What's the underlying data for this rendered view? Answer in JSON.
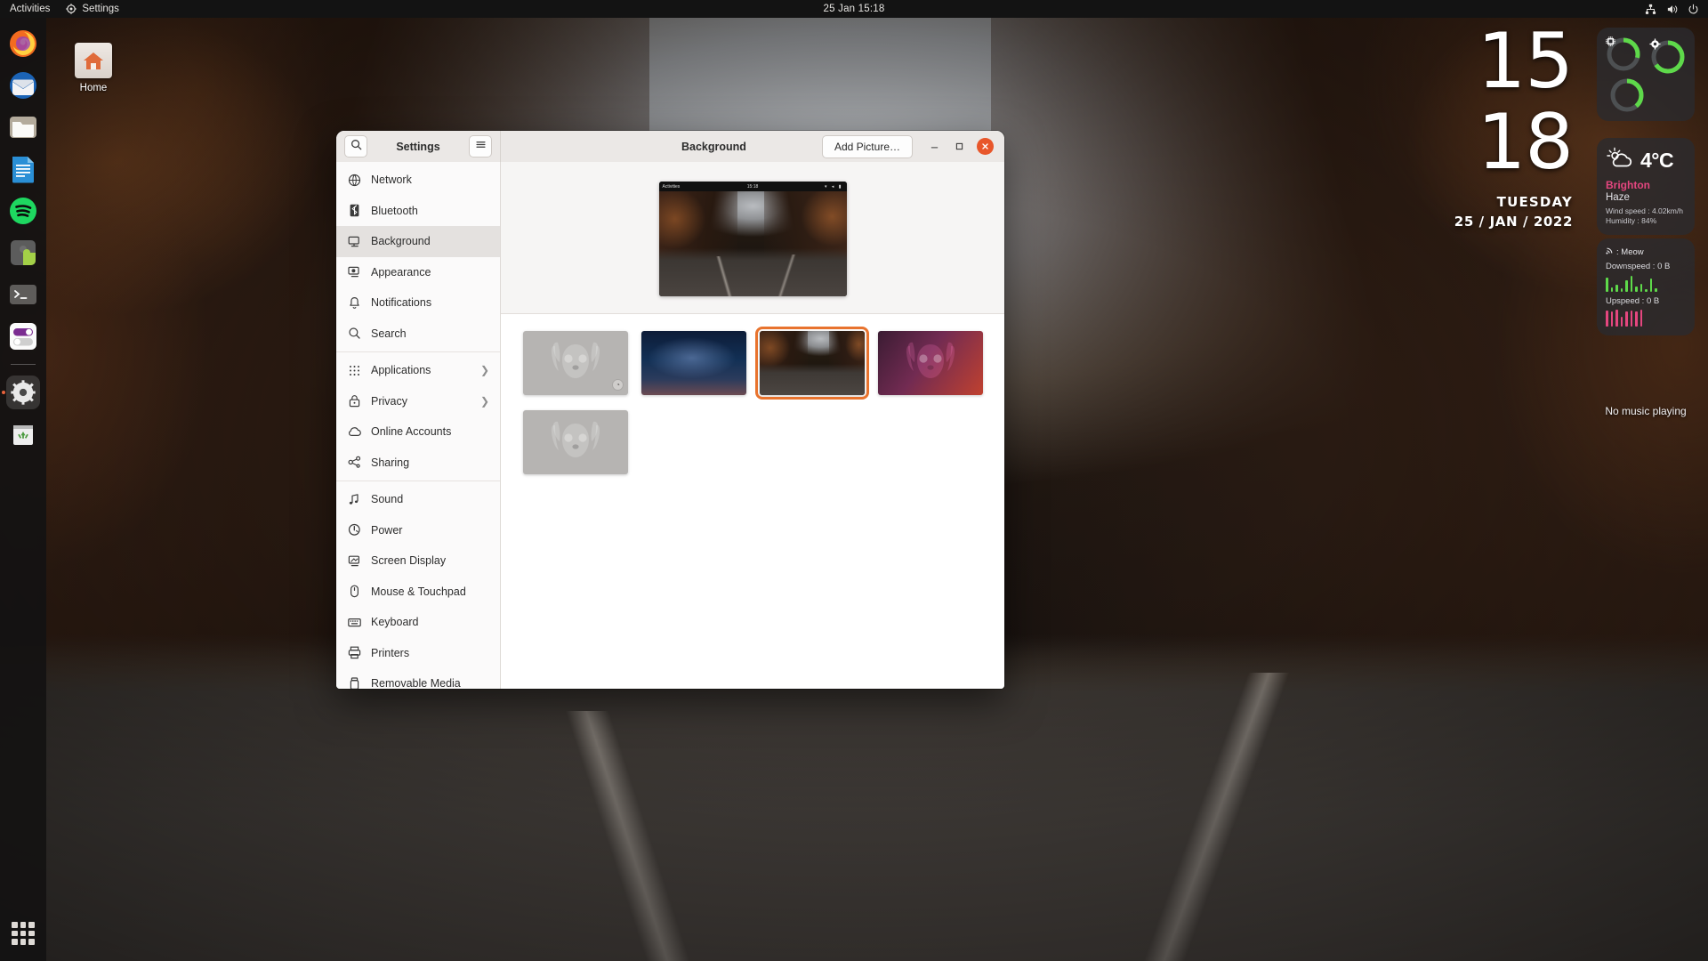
{
  "topbar": {
    "activities": "Activities",
    "app_name": "Settings",
    "app_icon": "gear-icon",
    "clock": "25 Jan  15:18",
    "tray": [
      {
        "name": "network-icon",
        "glyph": "⛓"
      },
      {
        "name": "volume-icon",
        "glyph": "▶"
      },
      {
        "name": "power-icon",
        "glyph": "⏻"
      }
    ]
  },
  "dock": {
    "items": [
      {
        "name": "firefox",
        "label": "Firefox"
      },
      {
        "name": "thunderbird",
        "label": "Thunderbird"
      },
      {
        "name": "files",
        "label": "Files"
      },
      {
        "name": "libreoffice-writer",
        "label": "LibreOffice Writer"
      },
      {
        "name": "spotify",
        "label": "Spotify"
      },
      {
        "name": "extensions",
        "label": "Extensions"
      },
      {
        "name": "terminal",
        "label": "Terminal"
      },
      {
        "name": "tweaks",
        "label": "Tweaks"
      },
      {
        "name": "settings",
        "label": "Settings",
        "running": true
      },
      {
        "name": "trash",
        "label": "Trash"
      }
    ],
    "show_apps_label": "Show Applications"
  },
  "desktop": {
    "home_icon_label": "Home"
  },
  "conky": {
    "hours": "15",
    "minutes": "18",
    "weekday": "TUESDAY",
    "date": "25 / JAN / 2022",
    "system": {
      "gauges": [
        {
          "name": "memory-gauge",
          "icon": "chip-icon",
          "percent": 28
        },
        {
          "name": "cpu-gauge",
          "icon": "gear-icon",
          "percent": 62
        },
        {
          "name": "disk-gauge",
          "icon": "",
          "percent": 38
        }
      ]
    },
    "weather": {
      "icon": "sun-cloud-icon",
      "temperature": "4°C",
      "city": "Brighton",
      "condition": "Haze",
      "wind": "Wind speed : 4.02km/h",
      "humidity": "Humidity : 84%"
    },
    "network": {
      "ssid": "\u0001 : Meow",
      "ssid_label": ": Meow",
      "downspeed": "Downspeed : 0 B",
      "upspeed": "Upspeed : 0 B",
      "down_bars": [
        16,
        5,
        8,
        4,
        13,
        18,
        6,
        9,
        3,
        15,
        4
      ],
      "up_bars": [
        18,
        17,
        19,
        11,
        17,
        18,
        17,
        19
      ]
    },
    "music": "No music playing",
    "colors": {
      "accent_green": "#5ed94a",
      "accent_pink": "#e4467f",
      "city_pink": "#e4467f"
    }
  },
  "settings_window": {
    "sidebar_title": "Settings",
    "search_icon": "search-icon",
    "menu_icon": "hamburger-icon",
    "page_title": "Background",
    "add_picture_label": "Add Picture…",
    "window_buttons": {
      "minimize": "–",
      "maximize": "□",
      "close": "✕"
    },
    "nav": [
      {
        "label": "Network",
        "icon": "globe-icon",
        "active": false,
        "chevron": false
      },
      {
        "label": "Bluetooth",
        "icon": "bluetooth-icon",
        "active": false,
        "chevron": false
      },
      {
        "label": "Background",
        "icon": "monitor-icon",
        "active": true,
        "chevron": false
      },
      {
        "label": "Appearance",
        "icon": "appearance-icon",
        "active": false,
        "chevron": false
      },
      {
        "label": "Notifications",
        "icon": "bell-icon",
        "active": false,
        "chevron": false
      },
      {
        "label": "Search",
        "icon": "search-icon",
        "active": false,
        "chevron": false
      },
      {
        "label": "Applications",
        "icon": "apps-grid-icon",
        "active": false,
        "chevron": true
      },
      {
        "label": "Privacy",
        "icon": "lock-icon",
        "active": false,
        "chevron": true
      },
      {
        "label": "Online Accounts",
        "icon": "cloud-icon",
        "active": false,
        "chevron": false
      },
      {
        "label": "Sharing",
        "icon": "share-icon",
        "active": false,
        "chevron": false
      },
      {
        "label": "Sound",
        "icon": "music-note-icon",
        "active": false,
        "chevron": false
      },
      {
        "label": "Power",
        "icon": "power-icon",
        "active": false,
        "chevron": false
      },
      {
        "label": "Screen Display",
        "icon": "screen-icon",
        "active": false,
        "chevron": false
      },
      {
        "label": "Mouse & Touchpad",
        "icon": "mouse-icon",
        "active": false,
        "chevron": false
      },
      {
        "label": "Keyboard",
        "icon": "keyboard-icon",
        "active": false,
        "chevron": false
      },
      {
        "label": "Printers",
        "icon": "printer-icon",
        "active": false,
        "chevron": false
      },
      {
        "label": "Removable Media",
        "icon": "usb-icon",
        "active": false,
        "chevron": false
      }
    ],
    "preview": {
      "mini_activities": "Activities",
      "mini_clock": "15:18",
      "mini_tray": "▾ ◂ ▮"
    },
    "wallpapers": [
      {
        "name": "wallpaper-grey-mascot",
        "style": "th-grey",
        "mascot": true,
        "selected": false,
        "badge": "◔"
      },
      {
        "name": "wallpaper-space",
        "style": "th-space",
        "mascot": false,
        "selected": false,
        "badge": ""
      },
      {
        "name": "wallpaper-forest-road",
        "style": "th-road",
        "mascot": false,
        "selected": true,
        "badge": ""
      },
      {
        "name": "wallpaper-purple-mascot",
        "style": "th-purple",
        "mascot": true,
        "selected": false,
        "badge": ""
      },
      {
        "name": "wallpaper-grey-mascot-2",
        "style": "th-grey",
        "mascot": true,
        "selected": false,
        "badge": ""
      }
    ],
    "colors": {
      "selection_orange": "#e8732e",
      "close_button": "#e8562a",
      "active_row": "#e4e1df"
    }
  }
}
